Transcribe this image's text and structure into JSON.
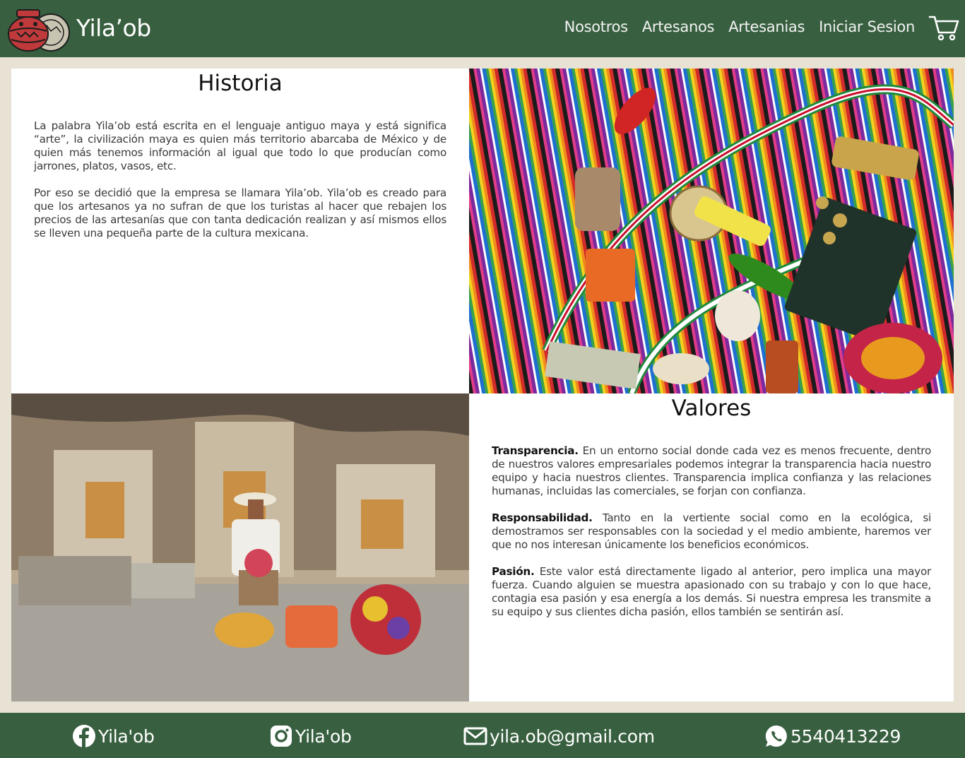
{
  "header": {
    "brand": "Yila’ob",
    "nav": [
      "Nosotros",
      "Artesanos",
      "Artesanias",
      "Iniciar Sesion"
    ],
    "colors": {
      "bar": "#386040",
      "text": "#ffffff"
    },
    "icons": {
      "logo": "clay-pot-logo",
      "cart": "shopping-cart-icon"
    }
  },
  "historia": {
    "title": "Historia",
    "paragraphs": [
      "La palabra Yila’ob está escrita en el lenguaje antiguo maya y está significa “arte”, la civilización maya es quien más territorio abarcaba de México y de quien más tenemos información al igual que todo lo que producían como jarrones, platos, vasos, etc.",
      "Por eso se decidió que la empresa se llamara Yila’ob. Yila’ob es creado para que los artesanos ya no sufran de que los turistas al hacer que rebajen los precios de las artesanías que con tanta dedicación realizan y así mismos ellos se lleven una pequeña parte de la cultura mexicana."
    ]
  },
  "valores": {
    "title": "Valores",
    "items": [
      {
        "term": "Transparencia.",
        "text": " En un entorno social donde cada vez es menos frecuente, dentro de nuestros valores empresariales podemos integrar la transparencia hacia nuestro equipo y hacia nuestros clientes. Transparencia implica confianza y las relaciones humanas, incluidas las comerciales, se forjan con confianza."
      },
      {
        "term": "Responsabilidad.",
        "text": " Tanto en la vertiente social como en la ecológica, si demostramos ser responsables con la sociedad y el medio ambiente, haremos ver que no nos interesan únicamente los beneficios económicos."
      },
      {
        "term": "Pasión.",
        "text": " Este valor está directamente ligado al anterior, pero implica una mayor fuerza. Cuando alguien se muestra apasionado con su trabajo y con lo que hace, contagia esa pasión y esa energía a los demás. Si nuestra empresa les transmite a su equipo y sus clientes dicha pasión, ellos también se sentirán así."
      }
    ]
  },
  "images": {
    "crafts": "photo-mexican-crafts-on-serape",
    "artisan": "photo-artisan-with-baskets-and-flowers"
  },
  "footer": {
    "facebook": "Yila'ob",
    "instagram": "Yila'ob",
    "email": "yila.ob@gmail.com",
    "phone": "5540413229",
    "icons": [
      "facebook-icon",
      "instagram-icon",
      "mail-icon",
      "whatsapp-icon"
    ]
  }
}
